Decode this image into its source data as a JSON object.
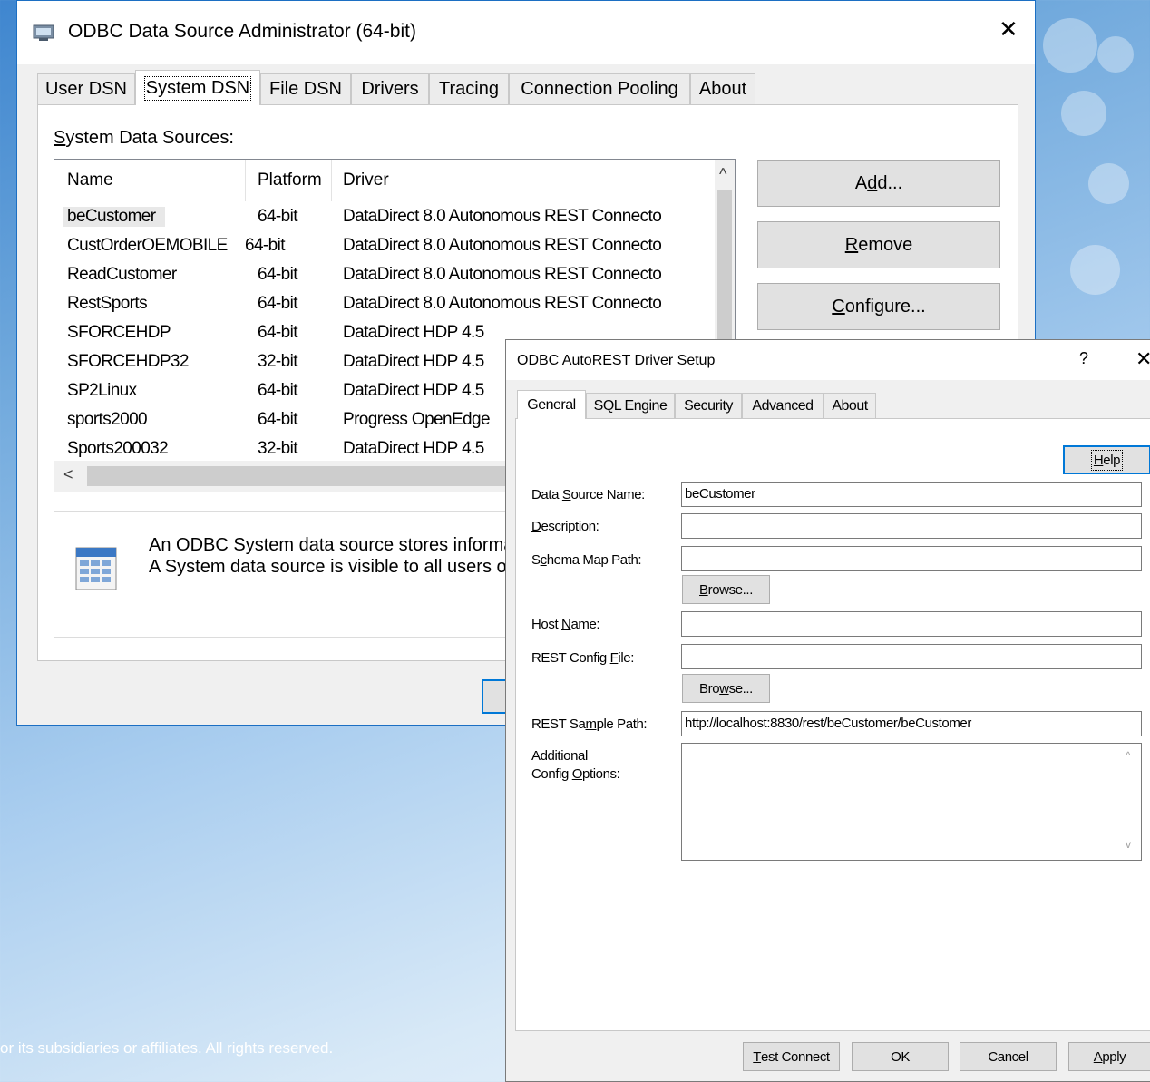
{
  "footer": {
    "text": "or its subsidiaries or affiliates. All rights reserved."
  },
  "main_window": {
    "title": "ODBC Data Source Administrator (64-bit)",
    "close_glyph": "✕",
    "tabs": [
      {
        "label": "User DSN"
      },
      {
        "label": "System DSN"
      },
      {
        "label": "File DSN"
      },
      {
        "label": "Drivers"
      },
      {
        "label": "Tracing"
      },
      {
        "label": "Connection Pooling"
      },
      {
        "label": "About"
      }
    ],
    "section_label": {
      "first": "S",
      "rest": "ystem Data Sources:"
    },
    "columns": {
      "name": "Name",
      "platform": "Platform",
      "driver": "Driver"
    },
    "rows": [
      {
        "name": "beCustomer",
        "platform": "64-bit",
        "driver": "DataDirect 8.0 Autonomous REST Connecto"
      },
      {
        "name": "CustOrderOEMOBILE",
        "platform": "64-bit",
        "driver": "DataDirect 8.0 Autonomous REST Connecto"
      },
      {
        "name": "ReadCustomer",
        "platform": "64-bit",
        "driver": "DataDirect 8.0 Autonomous REST Connecto"
      },
      {
        "name": "RestSports",
        "platform": "64-bit",
        "driver": "DataDirect 8.0 Autonomous REST Connecto"
      },
      {
        "name": "SFORCEHDP",
        "platform": "64-bit",
        "driver": "DataDirect HDP 4.5"
      },
      {
        "name": "SFORCEHDP32",
        "platform": "32-bit",
        "driver": "DataDirect HDP 4.5"
      },
      {
        "name": "SP2Linux",
        "platform": "64-bit",
        "driver": "DataDirect HDP 4.5"
      },
      {
        "name": "sports2000",
        "platform": "64-bit",
        "driver": "Progress OpenEdge"
      },
      {
        "name": "Sports200032",
        "platform": "32-bit",
        "driver": "DataDirect HDP 4.5"
      }
    ],
    "buttons": {
      "add": {
        "pre": "A",
        "key": "d",
        "post": "d..."
      },
      "remove": {
        "pre": "",
        "key": "R",
        "post": "emove"
      },
      "configure": {
        "pre": "",
        "key": "C",
        "post": "onfigure..."
      }
    },
    "info": {
      "line1": "An ODBC System data source stores informa",
      "line2": "A System data source is visible to all users of"
    },
    "scroll_up_glyph": "^",
    "scroll_left_glyph": "<"
  },
  "setup_dialog": {
    "title": "ODBC AutoREST Driver Setup",
    "help_glyph": "?",
    "close_glyph": "✕",
    "tabs": [
      {
        "label": "General"
      },
      {
        "label": "SQL Engine"
      },
      {
        "label": "Security"
      },
      {
        "label": "Advanced"
      },
      {
        "label": "About"
      }
    ],
    "help_button": {
      "key": "H",
      "post": "elp"
    },
    "fields": {
      "data_source_name": {
        "pre": "Data ",
        "key": "S",
        "post": "ource Name:",
        "value": "beCustomer"
      },
      "description": {
        "pre": "",
        "key": "D",
        "post": "escription:",
        "value": ""
      },
      "schema_map_path": {
        "pre": "S",
        "key": "c",
        "post": "hema Map Path:",
        "value": ""
      },
      "host_name": {
        "pre": "Host ",
        "key": "N",
        "post": "ame:",
        "value": ""
      },
      "rest_config_file": {
        "pre": "REST Config ",
        "key": "F",
        "post": "ile:",
        "value": ""
      },
      "rest_sample_path": {
        "pre": "REST Sa",
        "key": "m",
        "post": "ple Path:",
        "value": "http://localhost:8830/rest/beCustomer/beCustomer"
      },
      "additional_config": {
        "line1": "Additional",
        "line2_pre": "Config ",
        "key": "O",
        "line2_post": "ptions:",
        "value": ""
      }
    },
    "browse1": {
      "key": "B",
      "post": "rowse..."
    },
    "browse2": {
      "pre": "Bro",
      "key": "w",
      "post": "se..."
    },
    "footer_buttons": {
      "test_connect": {
        "key": "T",
        "post": "est Connect"
      },
      "ok": "OK",
      "cancel": "Cancel",
      "apply": {
        "key": "A",
        "post": "pply"
      }
    },
    "ta_up_glyph": "^",
    "ta_down_glyph": "v"
  },
  "colors": {
    "accent": "#0078d7",
    "window_border": "#1c6fc3",
    "dialog_bg": "#f0f0f0"
  }
}
